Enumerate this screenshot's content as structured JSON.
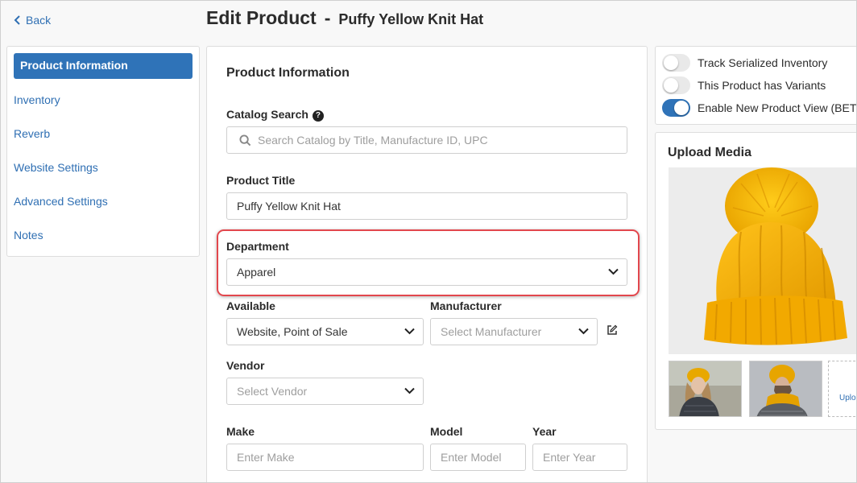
{
  "header": {
    "back_label": "Back",
    "title": "Edit Product",
    "separator": "-",
    "product_name": "Puffy Yellow Knit Hat"
  },
  "sidebar": {
    "items": [
      {
        "label": "Product Information",
        "active": true
      },
      {
        "label": "Inventory"
      },
      {
        "label": "Reverb"
      },
      {
        "label": "Website Settings"
      },
      {
        "label": "Advanced Settings"
      },
      {
        "label": "Notes"
      }
    ]
  },
  "form": {
    "section_title": "Product Information",
    "catalog_search": {
      "label": "Catalog Search",
      "help": "?",
      "placeholder": "Search Catalog by Title, Manufacture ID, UPC"
    },
    "product_title": {
      "label": "Product Title",
      "value": "Puffy Yellow Knit Hat"
    },
    "department": {
      "label": "Department",
      "value": "Apparel"
    },
    "available": {
      "label": "Available",
      "value": "Website, Point of Sale"
    },
    "manufacturer": {
      "label": "Manufacturer",
      "placeholder": "Select Manufacturer"
    },
    "vendor": {
      "label": "Vendor",
      "placeholder": "Select Vendor"
    },
    "make": {
      "label": "Make",
      "placeholder": "Enter Make"
    },
    "model": {
      "label": "Model",
      "placeholder": "Enter Model"
    },
    "year": {
      "label": "Year",
      "placeholder": "Enter Year"
    }
  },
  "toggles": [
    {
      "label": "Track Serialized Inventory",
      "on": false
    },
    {
      "label": "This Product has Variants",
      "on": false
    },
    {
      "label": "Enable New Product View (BET",
      "on": true
    }
  ],
  "media": {
    "title": "Upload Media",
    "upload_label": "Uplo"
  },
  "colors": {
    "accent": "#2f73b8",
    "link": "#2f6fb3",
    "highlight": "#e2474d",
    "product": "#f5b000"
  }
}
